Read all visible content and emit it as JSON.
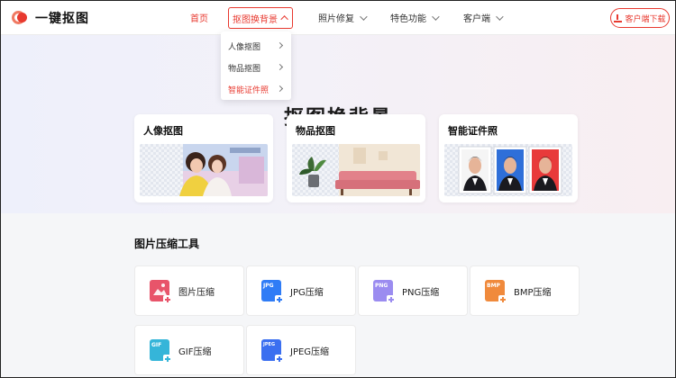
{
  "header": {
    "logo_text": "一键抠图",
    "nav": [
      {
        "label": "首页"
      },
      {
        "label": "抠图换背景"
      },
      {
        "label": "照片修复"
      },
      {
        "label": "特色功能"
      },
      {
        "label": "客户端"
      }
    ],
    "download_label": "客户端下载"
  },
  "dropdown": {
    "items": [
      {
        "label": "人像抠图"
      },
      {
        "label": "物品抠图"
      },
      {
        "label": "智能证件照"
      }
    ]
  },
  "hero": {
    "title": "抠图换背景",
    "cards": [
      {
        "title": "人像抠图"
      },
      {
        "title": "物品抠图"
      },
      {
        "title": "智能证件照"
      }
    ]
  },
  "compress": {
    "title": "图片压缩工具",
    "tools": [
      {
        "label": "图片压缩",
        "icon": "image-compress-icon",
        "tag": "",
        "color": "#e8546a"
      },
      {
        "label": "JPG压缩",
        "icon": "jpg-compress-icon",
        "tag": "JPG",
        "color": "#2f7cf6"
      },
      {
        "label": "PNG压缩",
        "icon": "png-compress-icon",
        "tag": "PNG",
        "color": "#9b8cf0"
      },
      {
        "label": "BMP压缩",
        "icon": "bmp-compress-icon",
        "tag": "BMP",
        "color": "#f08a3c"
      },
      {
        "label": "GIF压缩",
        "icon": "gif-compress-icon",
        "tag": "GIF",
        "color": "#35b5d9"
      },
      {
        "label": "JPEG压缩",
        "icon": "jpeg-compress-icon",
        "tag": "JPEG",
        "color": "#3b6ff0"
      }
    ]
  },
  "colors": {
    "accent": "#e8392f"
  }
}
